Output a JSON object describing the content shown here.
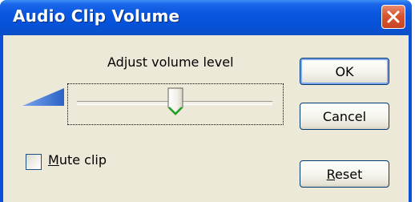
{
  "window": {
    "title": "Audio Clip Volume"
  },
  "volume": {
    "label": "Adjust volume level",
    "slider_level_percent": 47
  },
  "mute": {
    "label_mnemonic": "M",
    "label_rest": "ute clip",
    "checked": false
  },
  "buttons": {
    "ok": "OK",
    "cancel": "Cancel",
    "reset_mnemonic": "R",
    "reset_rest": "eset"
  },
  "icons": {
    "close": "close-icon",
    "volume_ramp": "volume-ramp-icon",
    "slider_thumb": "slider-thumb-icon"
  },
  "colors": {
    "titlebar": "#0a57e0",
    "client_bg": "#ece9d8",
    "close_button": "#d8542f",
    "button_border": "#003c74",
    "default_button_highlight": "#7ea7ee",
    "volume_ramp": "#3a6fd0"
  }
}
